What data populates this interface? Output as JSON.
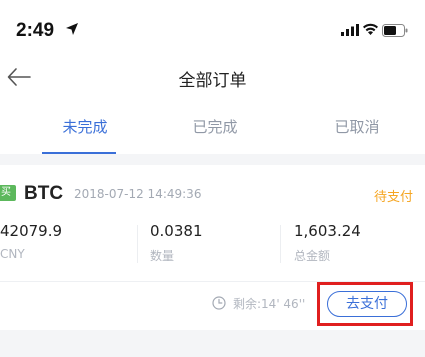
{
  "status_bar": {
    "time": "2:49",
    "icons": [
      "location-arrow-icon",
      "signal-icon",
      "wifi-icon",
      "battery-icon"
    ]
  },
  "nav": {
    "back_icon": "arrow-left-icon",
    "title": "全部订单"
  },
  "tabs": [
    {
      "label": "未完成",
      "active": true
    },
    {
      "label": "已完成",
      "active": false
    },
    {
      "label": "已取消",
      "active": false
    }
  ],
  "order": {
    "side": "买",
    "coin": "BTC",
    "time": "2018-07-12 14:49:36",
    "status": "待支付",
    "price": {
      "value": "42079.9",
      "label": "CNY"
    },
    "amount": {
      "value": "0.0381",
      "label": "数量"
    },
    "total": {
      "value": "1,603.24",
      "label": "总金额"
    },
    "countdown": "剩余:14' 46''",
    "pay_button": "去支付"
  },
  "colors": {
    "accent": "#3a6fd8",
    "status_pending": "#f5a623",
    "buy_badge": "#5cb85c",
    "highlight": "#e01f1f"
  }
}
